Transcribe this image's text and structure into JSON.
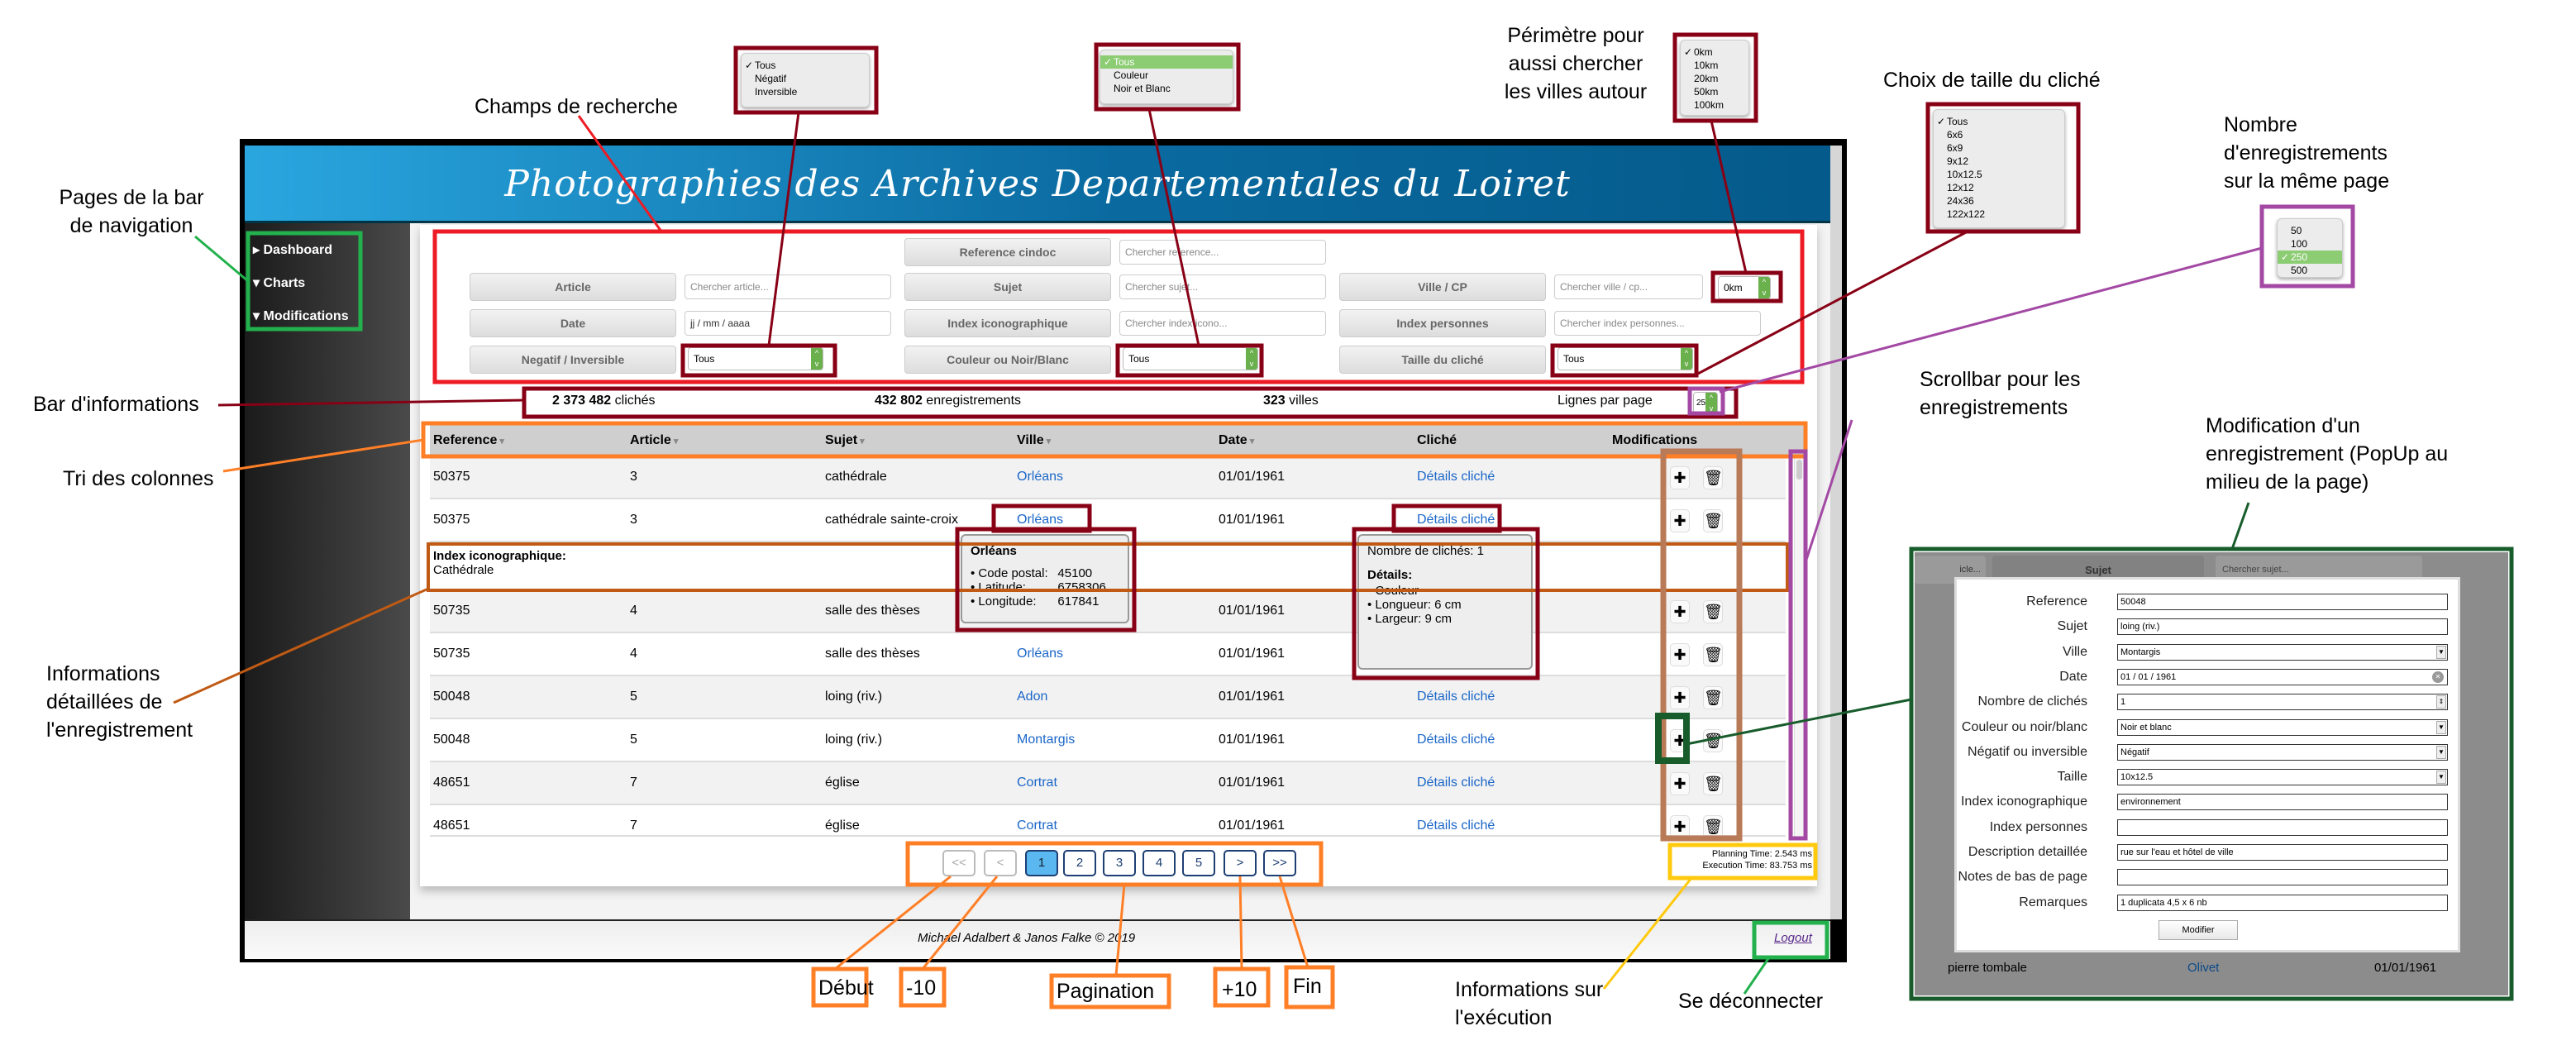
{
  "app": {
    "title": "Photographies des Archives Departementales du Loiret",
    "nav": [
      {
        "label": "Dashboard",
        "icon": "triangle-right-icon"
      },
      {
        "label": "Charts",
        "icon": "triangle-down-icon"
      },
      {
        "label": "Modifications",
        "icon": "triangle-down-icon"
      }
    ],
    "search": {
      "reference": {
        "label": "Reference cindoc",
        "placeholder": "Chercher reference..."
      },
      "article": {
        "label": "Article",
        "placeholder": "Chercher article..."
      },
      "sujet": {
        "label": "Sujet",
        "placeholder": "Chercher sujet..."
      },
      "ville": {
        "label": "Ville / CP",
        "placeholder": "Chercher ville / cp...",
        "perimetre": "0km"
      },
      "date": {
        "label": "Date",
        "placeholder": "jj / mm / aaaa"
      },
      "index_icono": {
        "label": "Index iconographique",
        "placeholder": "Chercher index icono..."
      },
      "index_personnes": {
        "label": "Index personnes",
        "placeholder": "Chercher index personnes..."
      },
      "negatif": {
        "label": "Negatif / Inversible",
        "value": "Tous"
      },
      "couleur": {
        "label": "Couleur ou Noir/Blanc",
        "value": "Tous"
      },
      "taille": {
        "label": "Taille du cliché",
        "value": "Tous"
      }
    },
    "infobar": {
      "cliches_count": "2 373 482",
      "cliches_label": "clichés",
      "records_count": "432 802",
      "records_label": "enregistrements",
      "villes_count": "323",
      "villes_label": "villes",
      "lines_label": "Lignes par page",
      "lines_value": "250"
    },
    "table": {
      "columns": [
        "Reference",
        "Article",
        "Sujet",
        "Ville",
        "Date",
        "Cliché",
        "Modifications"
      ],
      "sort_icon": "caret-down-icon",
      "rows": [
        [
          "50375",
          "3",
          "cathédrale",
          "Orléans",
          "01/01/1961",
          "Détails cliché"
        ],
        [
          "50375",
          "3",
          "cathédrale sainte-croix",
          "Orléans",
          "01/01/1961",
          "Détails cliché"
        ],
        [
          "50735",
          "4",
          "salle des thèses",
          "Orléans",
          "01/01/1961",
          "Détails cliché"
        ],
        [
          "50735",
          "4",
          "salle des thèses",
          "Orléans",
          "01/01/1961",
          "Détails cliché"
        ],
        [
          "50048",
          "5",
          "loing (riv.)",
          "Adon",
          "01/01/1961",
          "Détails cliché"
        ],
        [
          "50048",
          "5",
          "loing (riv.)",
          "Montargis",
          "01/01/1961",
          "Détails cliché"
        ],
        [
          "48651",
          "7",
          "église",
          "Cortrat",
          "01/01/1961",
          "Détails cliché"
        ],
        [
          "48651",
          "7",
          "église",
          "Cortrat",
          "01/01/1961",
          "Détails cliché"
        ]
      ],
      "detail": {
        "label": "Index iconographique:",
        "value": "Cathédrale"
      },
      "ville_popup": {
        "title": "Orléans",
        "items": [
          [
            "Code postal:",
            "45100"
          ],
          [
            "Latitude:",
            "6758306"
          ],
          [
            "Longitude:",
            "617841"
          ]
        ]
      },
      "cliche_popup": {
        "count_label": "Nombre de clichés:",
        "count": "1",
        "details_label": "Détails:",
        "items": [
          "Couleur",
          "Longueur: 6 cm",
          "Largeur:   9 cm"
        ]
      }
    },
    "pagination": [
      "<<",
      "<",
      "1",
      "2",
      "3",
      "4",
      "5",
      ">",
      ">>"
    ],
    "pagination_active": "1",
    "exec": {
      "planning": "Planning Time: 2.543 ms",
      "execution": "Execution Time: 83.753 ms"
    },
    "footer": {
      "credits": "Michael Adalbert & Janos Falke © 2019",
      "logout": "Logout"
    }
  },
  "dropdowns": {
    "negatif": {
      "options": [
        "Tous",
        "Négatif",
        "Inversible"
      ],
      "selected": "Tous"
    },
    "couleur": {
      "options": [
        "Tous",
        "Couleur",
        "Noir et Blanc"
      ],
      "selected": "Tous"
    },
    "perimetre": {
      "options": [
        "0km",
        "10km",
        "20km",
        "50km",
        "100km"
      ],
      "selected": "0km"
    },
    "taille": {
      "options": [
        "Tous",
        "6x6",
        "6x9",
        "9x12",
        "10x12.5",
        "12x12",
        "24x36",
        "122x122"
      ],
      "selected": "Tous"
    },
    "lignes": {
      "options": [
        "50",
        "100",
        "250",
        "500"
      ],
      "selected": "250"
    }
  },
  "modal": {
    "bg": {
      "article_ph": "icle...",
      "sujet_label": "Sujet",
      "sujet_ph": "Chercher sujet...",
      "row": [
        "pierre tombale",
        "Olivet",
        "01/01/1961"
      ]
    },
    "fields": [
      {
        "label": "Reference",
        "value": "50048",
        "type": "text"
      },
      {
        "label": "Sujet",
        "value": "loing (riv.)",
        "type": "text"
      },
      {
        "label": "Ville",
        "value": "Montargis",
        "type": "select"
      },
      {
        "label": "Date",
        "value": "01 / 01 / 1961",
        "type": "date"
      },
      {
        "label": "Nombre de clichés",
        "value": "1",
        "type": "number"
      },
      {
        "label": "Couleur ou noir/blanc",
        "value": "Noir et blanc",
        "type": "select"
      },
      {
        "label": "Négatif ou inversible",
        "value": "Négatif",
        "type": "select"
      },
      {
        "label": "Taille",
        "value": "10x12.5",
        "type": "select"
      },
      {
        "label": "Index iconographique",
        "value": "environnement",
        "type": "text"
      },
      {
        "label": "Index personnes",
        "value": "",
        "type": "text"
      },
      {
        "label": "Description detaillée",
        "value": "rue sur l'eau et hôtel de ville",
        "type": "text"
      },
      {
        "label": "Notes de bas de page",
        "value": "",
        "type": "text"
      },
      {
        "label": "Remarques",
        "value": "1 duplicata 4,5 x 6 nb",
        "type": "text"
      }
    ],
    "submit": "Modifier"
  },
  "annotations": {
    "nav": "Pages de la bar de navigation",
    "search": "Champs de recherche",
    "perimetre": "Périmètre pour aussi chercher les villes autour",
    "taille": "Choix de taille du cliché",
    "lignes": "Nombre d'enregistrements sur la même page",
    "infobar": "Bar d'informations",
    "tri": "Tri des colonnes",
    "detail": "Informations détaillées de l'enregistrement",
    "scrollbar": "Scrollbar pour les enregistrements",
    "modif": "Modification d'un enregistrement (PopUp au milieu de la page)",
    "debut": "Début",
    "moins10": "-10",
    "pagination": "Pagination",
    "plus10": "+10",
    "fin": "Fin",
    "exec": "Informations sur l'exécution",
    "logout": "Se déconnecter"
  },
  "colors": {
    "header": "#0a6aa0",
    "accent_green": "#6ab04c",
    "link": "#1a66c8",
    "ann_red": "#ed1c24",
    "ann_darkred": "#880015",
    "ann_green": "#22b14c",
    "ann_orange": "#ff7f27",
    "ann_brown": "#b97a57",
    "ann_purple": "#a349a4",
    "ann_yellow": "#ffc90e",
    "ann_darkgreen": "#185c2c"
  }
}
